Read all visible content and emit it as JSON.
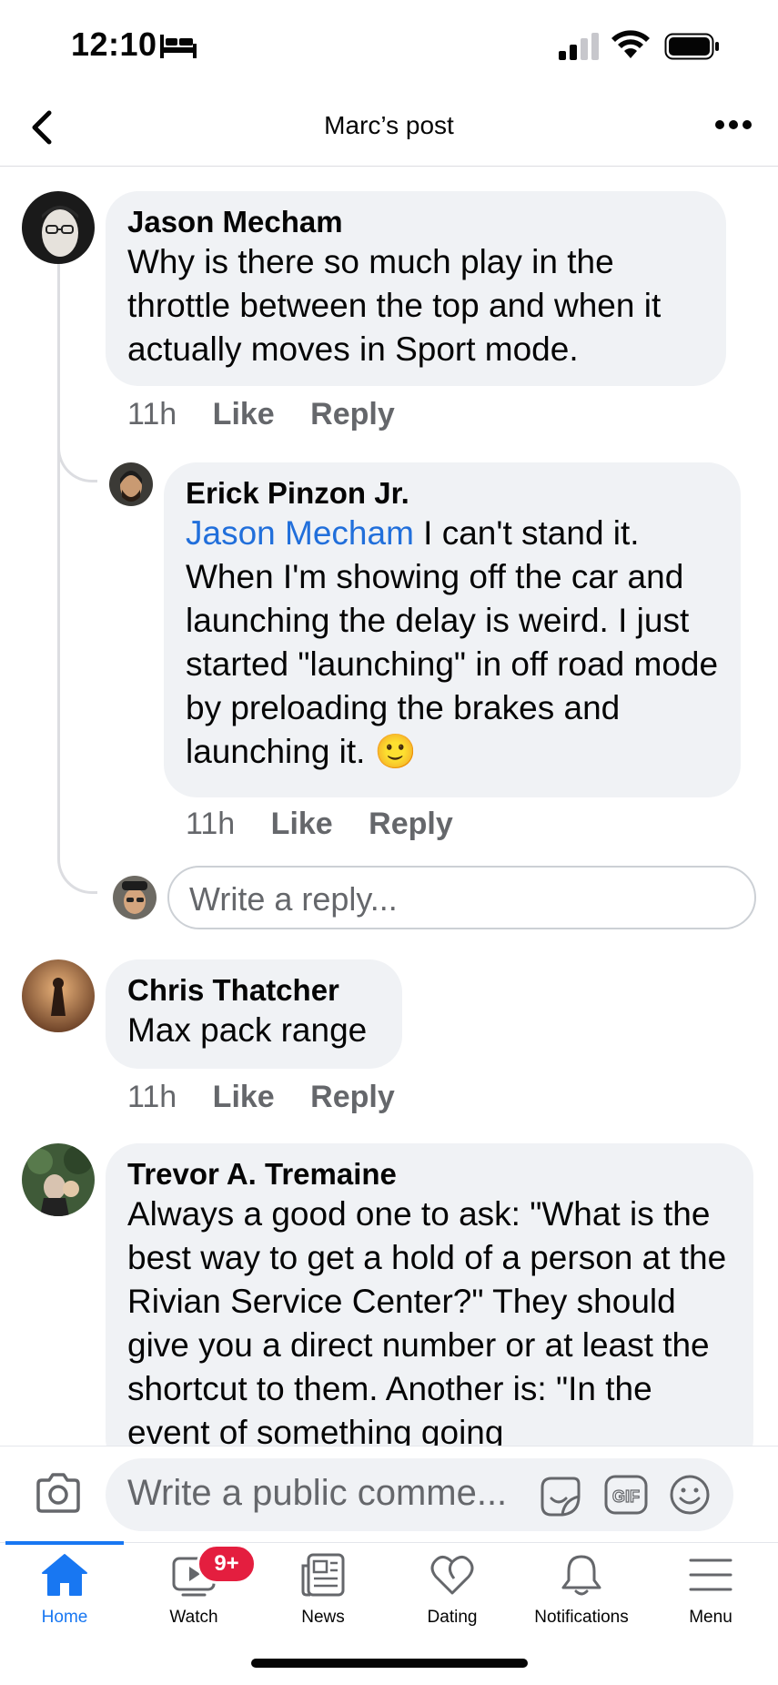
{
  "status_bar": {
    "time": "12:10"
  },
  "header": {
    "title": "Marc’s post"
  },
  "comments": [
    {
      "name": "Jason Mecham",
      "text": "Why is there so much play in the throttle between the top and when it actually moves in Sport mode.",
      "time": "11h",
      "like": "Like",
      "reply": "Reply"
    },
    {
      "name": "Erick Pinzon Jr.",
      "mention": "Jason Mecham",
      "text": " I can't stand it. When I'm showing off the car and launching the delay is weird. I just started \"launching\" in off road mode by preloading the brakes and launching it. 🙂",
      "time": "11h",
      "like": "Like",
      "reply": "Reply"
    },
    {
      "name": "Chris Thatcher",
      "text": "Max pack range",
      "time": "11h",
      "like": "Like",
      "reply": "Reply"
    },
    {
      "name": "Trevor A. Tremaine",
      "text": "Always a good one to ask: \"What is the best way to get a hold of a person at the Rivian Service Center?\" They should give you a direct number or at least the shortcut to them. Another is: \"In the event of something going"
    }
  ],
  "reply_input": {
    "placeholder": "Write a reply..."
  },
  "composer": {
    "placeholder": "Write a public comme..."
  },
  "tabs": [
    {
      "label": "Home",
      "icon": "home-icon",
      "active": true
    },
    {
      "label": "Watch",
      "icon": "watch-icon",
      "badge": "9+"
    },
    {
      "label": "News",
      "icon": "news-icon"
    },
    {
      "label": "Dating",
      "icon": "dating-icon"
    },
    {
      "label": "Notifications",
      "icon": "bell-icon"
    },
    {
      "label": "Menu",
      "icon": "menu-icon"
    }
  ],
  "colors": {
    "accent": "#1877f2",
    "mention": "#216fdb",
    "badge": "#e41e3f",
    "bubble": "#f0f2f5"
  }
}
